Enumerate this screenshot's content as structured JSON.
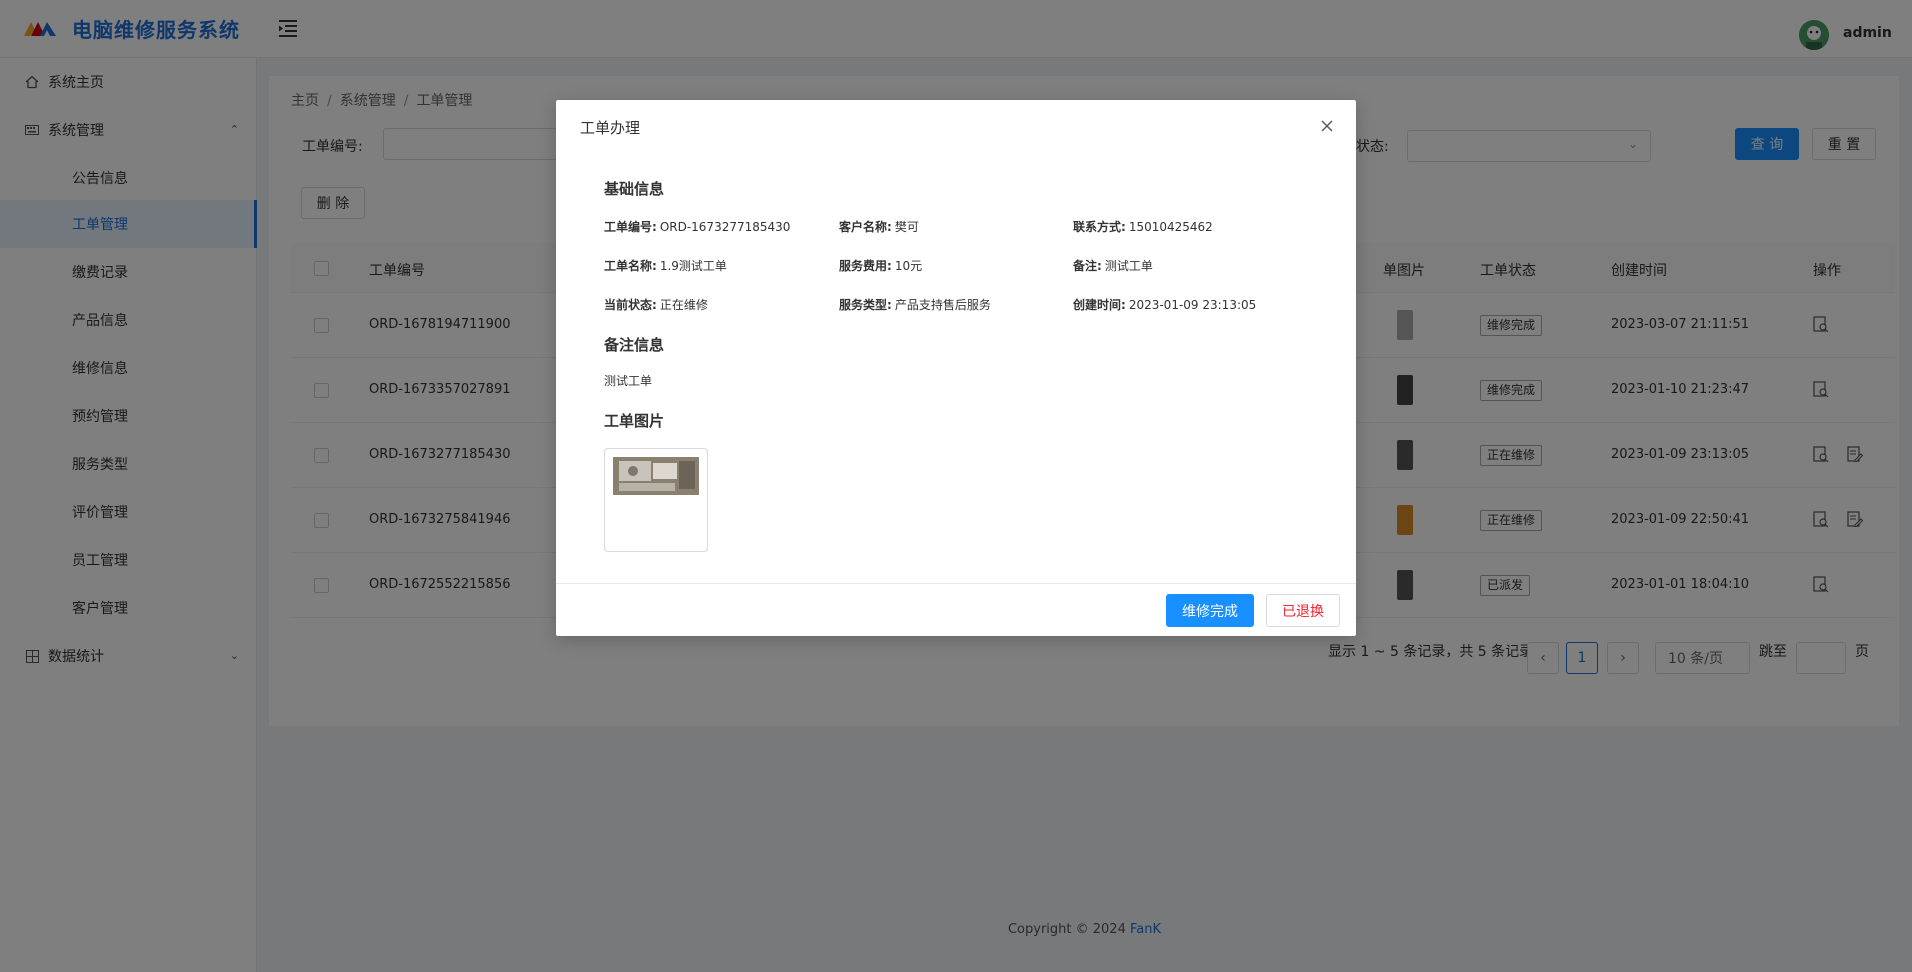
{
  "app": {
    "title": "电脑维修服务系统",
    "user": "admin"
  },
  "sidebar": {
    "items": [
      {
        "label": "系统主页",
        "icon": "home-icon"
      },
      {
        "label": "系统管理",
        "icon": "keyboard-icon",
        "expanded": true
      },
      {
        "label": "公告信息"
      },
      {
        "label": "工单管理",
        "active": true
      },
      {
        "label": "缴费记录"
      },
      {
        "label": "产品信息"
      },
      {
        "label": "维修信息"
      },
      {
        "label": "预约管理"
      },
      {
        "label": "服务类型"
      },
      {
        "label": "评价管理"
      },
      {
        "label": "员工管理"
      },
      {
        "label": "客户管理"
      },
      {
        "label": "数据统计",
        "icon": "chart-grid-icon"
      }
    ]
  },
  "breadcrumb": [
    "主页",
    "系统管理",
    "工单管理"
  ],
  "filters": {
    "order_no_label": "工单编号:",
    "status_label": "状态:",
    "search_label": "查 询",
    "reset_label": "重 置"
  },
  "toolbar": {
    "delete_label": "删 除"
  },
  "table": {
    "columns": [
      "工单编号",
      "单图片",
      "工单状态",
      "创建时间",
      "操作"
    ],
    "rows": [
      {
        "order_no": "ORD-1678194711900",
        "status": "维修完成",
        "created": "2023-03-07 21:11:51"
      },
      {
        "order_no": "ORD-1673357027891",
        "status": "维修完成",
        "created": "2023-01-10 21:23:47"
      },
      {
        "order_no": "ORD-1673277185430",
        "status": "正在维修",
        "created": "2023-01-09 23:13:05"
      },
      {
        "order_no": "ORD-1673275841946",
        "status": "正在维修",
        "created": "2023-01-09 22:50:41"
      },
      {
        "order_no": "ORD-1672552215856",
        "status": "已派发",
        "created": "2023-01-01 18:04:10"
      }
    ]
  },
  "pagination": {
    "summary": "显示 1 ~ 5 条记录，共 5 条记录",
    "current_page": "1",
    "page_size": "10 条/页",
    "jump_label": "跳至",
    "page_suffix": "页"
  },
  "footer": {
    "text": "Copyright © 2024",
    "brand": "FanK"
  },
  "modal": {
    "title": "工单办理",
    "basic_title": "基础信息",
    "fields": {
      "order_no_k": "工单编号:",
      "order_no_v": "ORD-1673277185430",
      "customer_k": "客户名称:",
      "customer_v": "樊可",
      "contact_k": "联系方式:",
      "contact_v": "15010425462",
      "name_k": "工单名称:",
      "name_v": "1.9测试工单",
      "fee_k": "服务费用:",
      "fee_v": "10元",
      "remark_k": "备注:",
      "remark_v": "测试工单",
      "status_k": "当前状态:",
      "status_v": "正在维修",
      "type_k": "服务类型:",
      "type_v": "产品支持售后服务",
      "created_k": "创建时间:",
      "created_v": "2023-01-09 23:13:05"
    },
    "remark_title": "备注信息",
    "remark_text": "测试工单",
    "image_title": "工单图片",
    "btn_complete": "维修完成",
    "btn_swapped": "已退换"
  },
  "colors": {
    "primary": "#1890ff",
    "brand": "#1f6fd6",
    "danger": "#f5222d"
  }
}
